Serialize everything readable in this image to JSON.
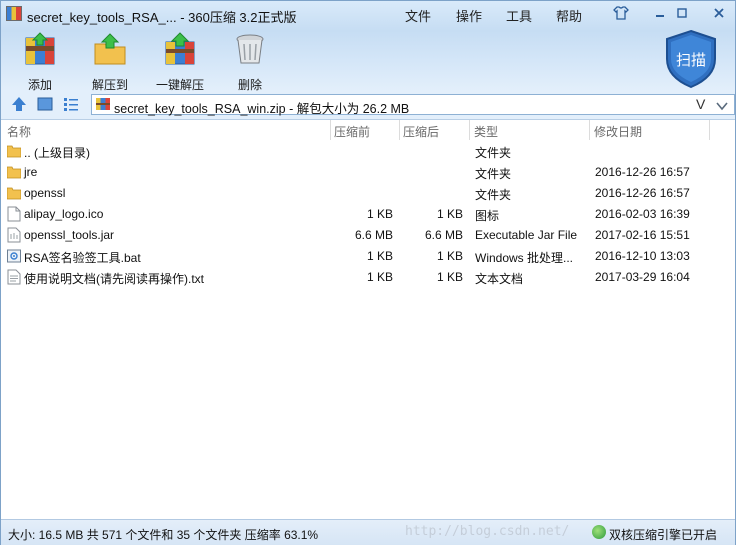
{
  "window": {
    "title": "secret_key_tools_RSA_... - 360压缩 3.2正式版",
    "menu": [
      "文件",
      "操作",
      "工具",
      "帮助"
    ]
  },
  "toolbar": {
    "add_label": "添加",
    "extract_label": "解压到",
    "one_click_label": "一键解压",
    "delete_label": "删除",
    "scan_label": "扫描"
  },
  "address": {
    "path": "secret_key_tools_RSA_win.zip - 解包大小为 26.2 MB"
  },
  "columns": {
    "name": "名称",
    "compressed": "压缩前",
    "after": "压缩后",
    "type": "类型",
    "modified": "修改日期"
  },
  "files": [
    {
      "name": ".. (上级目录)",
      "before": "",
      "after": "",
      "type": "文件夹",
      "date": "",
      "icon": "folder-icon"
    },
    {
      "name": "jre",
      "before": "",
      "after": "",
      "type": "文件夹",
      "date": "2016-12-26 16:57",
      "icon": "folder-icon"
    },
    {
      "name": "openssl",
      "before": "",
      "after": "",
      "type": "文件夹",
      "date": "2016-12-26 16:57",
      "icon": "folder-icon"
    },
    {
      "name": "alipay_logo.ico",
      "before": "1 KB",
      "after": "1 KB",
      "type": "图标",
      "date": "2016-02-03 16:39",
      "icon": "file-icon"
    },
    {
      "name": "openssl_tools.jar",
      "before": "6.6 MB",
      "after": "6.6 MB",
      "type": "Executable Jar File",
      "date": "2017-02-16 15:51",
      "icon": "jar-icon"
    },
    {
      "name": "RSA签名验签工具.bat",
      "before": "1 KB",
      "after": "1 KB",
      "type": "Windows 批处理...",
      "date": "2016-12-10 13:03",
      "icon": "bat-icon"
    },
    {
      "name": "使用说明文档(请先阅读再操作).txt",
      "before": "1 KB",
      "after": "1 KB",
      "type": "文本文档",
      "date": "2017-03-29 16:04",
      "icon": "txt-icon"
    }
  ],
  "status": {
    "summary": "大小: 16.5 MB 共 571 个文件和 35 个文件夹 压缩率 63.1%",
    "watermark": "http://blog.csdn.net/",
    "engine": "双核压缩引擎已开启"
  },
  "colors": {
    "accent": "#2f6fc0",
    "folder": "#f2c14e",
    "list_bg": "#ffffff"
  }
}
